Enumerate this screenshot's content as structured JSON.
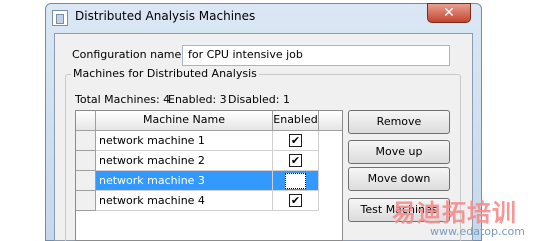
{
  "window": {
    "title": "Distributed Analysis Machines",
    "close_glyph": "✕"
  },
  "config": {
    "label": "Configuration name:",
    "value": "for CPU intensive job"
  },
  "group": {
    "title": "Machines for Distributed Analysis",
    "total": "Total Machines: 4",
    "enabled": "Enabled: 3",
    "disabled": "Disabled: 1"
  },
  "table": {
    "columns": [
      "Machine Name",
      "Enabled"
    ],
    "rows": [
      {
        "name": "network machine 1",
        "enabled": true,
        "selected": false
      },
      {
        "name": "network machine 2",
        "enabled": true,
        "selected": false
      },
      {
        "name": "network machine 3",
        "enabled": false,
        "selected": true
      },
      {
        "name": "network machine 4",
        "enabled": true,
        "selected": false
      }
    ]
  },
  "buttons": {
    "remove": "Remove",
    "move_up": "Move up",
    "move_down": "Move down",
    "test": "Test Machines"
  },
  "watermark": {
    "text": "易迪拓培训",
    "url": "www.edatop.com"
  },
  "colors": {
    "selection": "#3399ff",
    "close": "#c4452f"
  }
}
